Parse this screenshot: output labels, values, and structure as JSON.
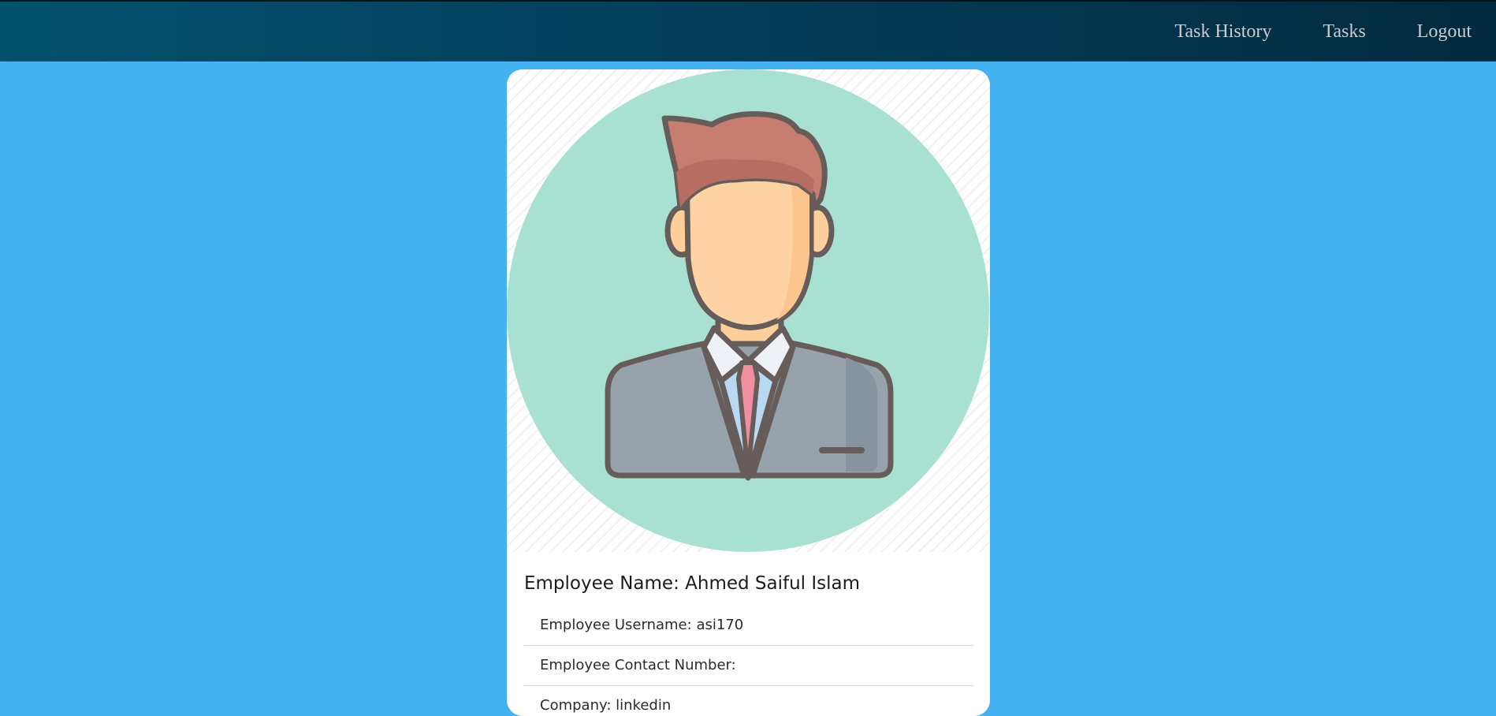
{
  "nav": {
    "items": [
      {
        "label": "Task History"
      },
      {
        "label": "Tasks"
      },
      {
        "label": "Logout"
      }
    ]
  },
  "profile": {
    "avatar_icon": "employee-avatar-icon",
    "name_label": "Employee Name:",
    "name_value": "Ahmed Saiful Islam",
    "fields": [
      {
        "label": "Employee Username:",
        "value": "asi170"
      },
      {
        "label": "Employee Contact Number:",
        "value": ""
      },
      {
        "label": "Company:",
        "value": "linkedin"
      }
    ]
  },
  "colors": {
    "page_bg": "#45b2f2",
    "nav_bg_start": "#03506f",
    "nav_bg_end": "#032a3f",
    "nav_text": "#c7cdd2",
    "card_bg": "#ffffff",
    "avatar_circle": "#a8e1d2"
  }
}
